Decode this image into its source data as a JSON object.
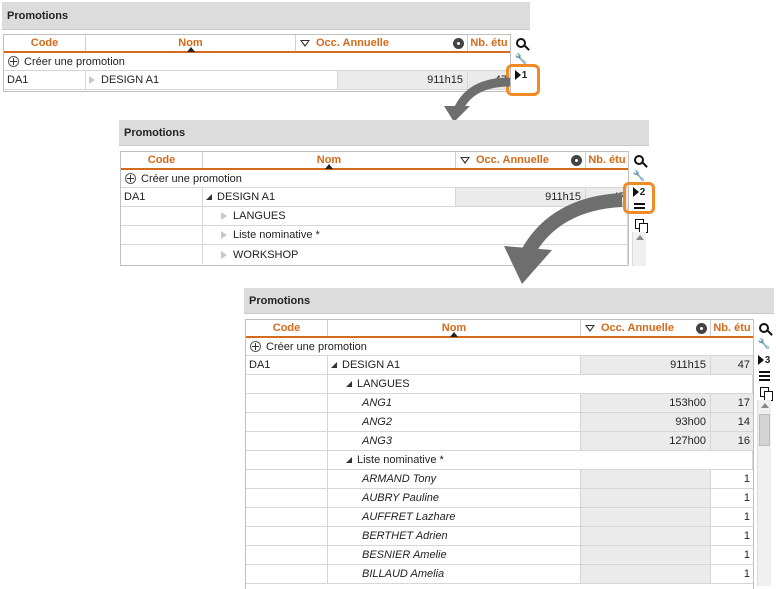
{
  "columns": {
    "code": "Code",
    "nom": "Nom",
    "occ": "Occ. Annuelle",
    "nb": "Nb. étu"
  },
  "create_label": "Créer une promotion",
  "panel1": {
    "title": "Promotions",
    "row": {
      "code": "DA1",
      "nom": "DESIGN A1",
      "occ": "911h15",
      "nb": "47"
    },
    "level_label": "1"
  },
  "panel2": {
    "title": "Promotions",
    "row": {
      "code": "DA1",
      "nom": "DESIGN A1",
      "occ": "911h15",
      "nb": "47"
    },
    "level_label": "2",
    "children": [
      "LANGUES",
      "Liste nominative *",
      "WORKSHOP"
    ]
  },
  "panel3": {
    "title": "Promotions",
    "row": {
      "code": "DA1",
      "nom": "DESIGN A1",
      "occ": "911h15",
      "nb": "47"
    },
    "level_label": "3",
    "group1": {
      "name": "LANGUES",
      "items": [
        {
          "nom": "ANG1",
          "occ": "153h00",
          "nb": "17"
        },
        {
          "nom": "ANG2",
          "occ": "93h00",
          "nb": "14"
        },
        {
          "nom": "ANG3",
          "occ": "127h00",
          "nb": "16"
        }
      ]
    },
    "group2": {
      "name": "Liste nominative *",
      "items": [
        {
          "nom": "ARMAND Tony",
          "nb": "1"
        },
        {
          "nom": "AUBRY Pauline",
          "nb": "1"
        },
        {
          "nom": "AUFFRET Lazhare",
          "nb": "1"
        },
        {
          "nom": "BERTHET Adrien",
          "nb": "1"
        },
        {
          "nom": "BESNIER Amelie",
          "nb": "1"
        },
        {
          "nom": "BILLAUD Amelia",
          "nb": "1"
        }
      ]
    }
  },
  "colors": {
    "accent": "#d46a1a",
    "highlight": "#f08a24",
    "arrow": "#6e6e6e"
  },
  "icons": [
    "search-icon",
    "wrench-icon",
    "level-icon",
    "lines-icon",
    "copy-icon",
    "plus-circle-icon"
  ]
}
